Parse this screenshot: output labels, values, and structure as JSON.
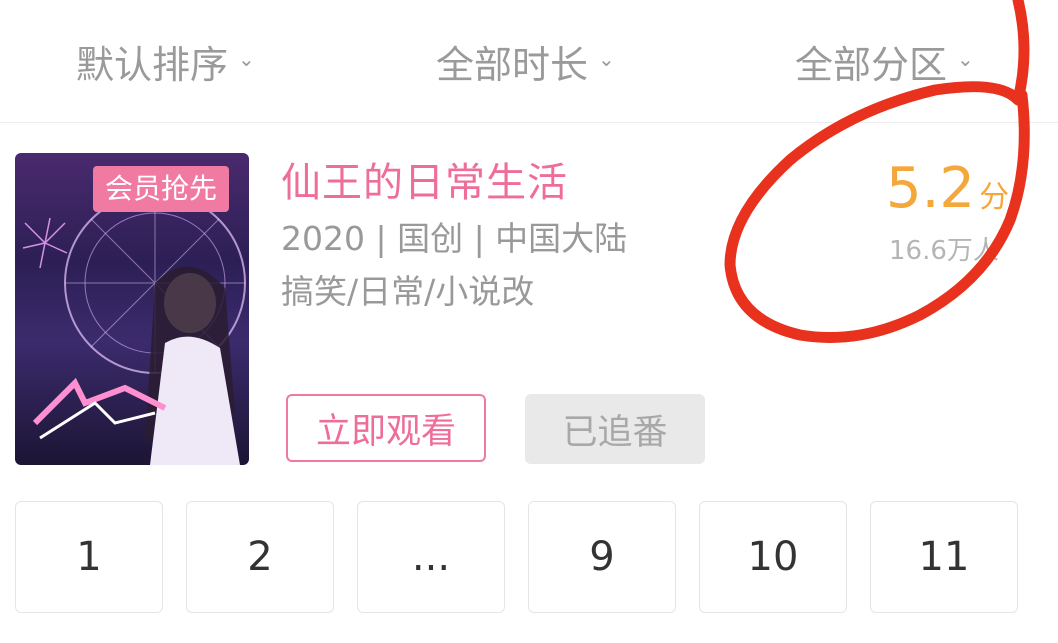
{
  "filters": {
    "sort": "默认排序",
    "duration": "全部时长",
    "area": "全部分区"
  },
  "anime": {
    "badge": "会员抢先",
    "title": "仙王的日常生活",
    "meta_line1": "2020 | 国创 | 中国大陆",
    "meta_line2": "搞笑/日常/小说改",
    "score": "5.2",
    "score_unit": "分",
    "followers": "16.6万人",
    "watch_label": "立即观看",
    "followed_label": "已追番"
  },
  "pagination": [
    "1",
    "2",
    "...",
    "9",
    "10",
    "11"
  ],
  "colors": {
    "accent_pink": "#ee6e99",
    "score_orange": "#f4a73a",
    "annotation_red": "#e8321e"
  }
}
